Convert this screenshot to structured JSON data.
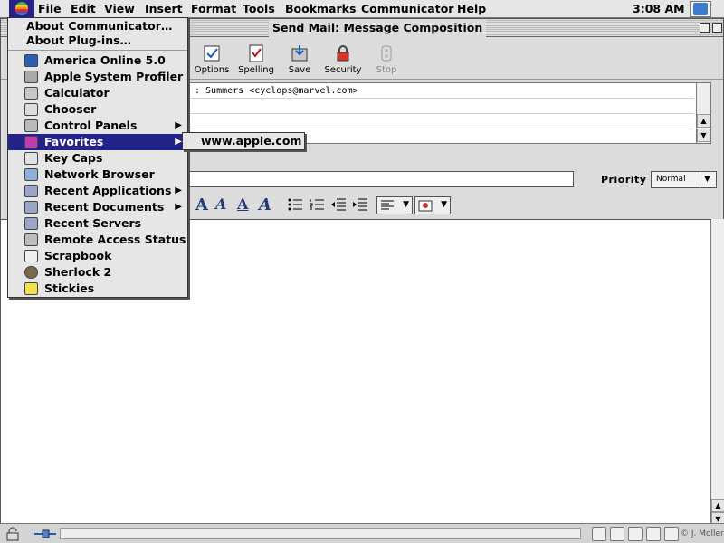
{
  "menubar": {
    "items": [
      "File",
      "Edit",
      "View",
      "Insert",
      "Format",
      "Tools",
      "Bookmarks",
      "Communicator",
      "Help"
    ],
    "clock": "3:08 AM"
  },
  "window": {
    "title": "Send Mail: Message Composition"
  },
  "toolbar": {
    "buttons": [
      "Options",
      "Spelling",
      "Save",
      "Security",
      "Stop"
    ]
  },
  "address": {
    "first_row": ": Summers <cyclops@marvel.com>"
  },
  "subject": {
    "priority_label": "Priority :",
    "priority_value": "Normal"
  },
  "apple_menu": {
    "about_items": [
      "About Communicator…",
      "About Plug-ins…"
    ],
    "items": [
      "America Online 5.0",
      "Apple System Profiler",
      "Calculator",
      "Chooser",
      "Control Panels",
      "Favorites",
      "Key Caps",
      "Network Browser",
      "Recent Applications",
      "Recent Documents",
      "Recent Servers",
      "Remote Access Status",
      "Scrapbook",
      "Sherlock 2",
      "Stickies"
    ],
    "highlighted": "Favorites"
  },
  "favorites_submenu": {
    "items": [
      "www.apple.com"
    ]
  },
  "status": {
    "credit": "© J. Moller"
  },
  "colors": {
    "highlight": "#22238b",
    "menu_bg": "#e6e6e6"
  }
}
